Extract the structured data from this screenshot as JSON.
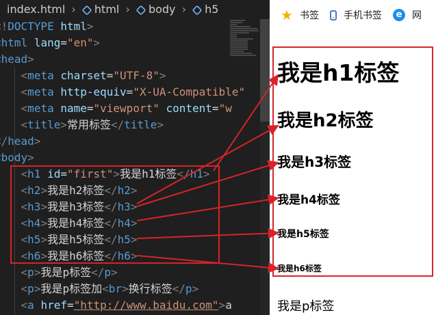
{
  "breadcrumb": {
    "file": "index.html",
    "items": [
      "html",
      "body",
      "h5"
    ]
  },
  "code_lines": [
    [
      {
        "c": "bracket",
        "t": "<!"
      },
      {
        "c": "tag",
        "t": "DOCTYPE"
      },
      {
        "c": "text",
        "t": " "
      },
      {
        "c": "attr",
        "t": "html"
      },
      {
        "c": "bracket",
        "t": ">"
      }
    ],
    [
      {
        "c": "bracket",
        "t": "<"
      },
      {
        "c": "tag",
        "t": "html"
      },
      {
        "c": "text",
        "t": " "
      },
      {
        "c": "attr",
        "t": "lang"
      },
      {
        "c": "text",
        "t": "="
      },
      {
        "c": "str",
        "t": "\"en\""
      },
      {
        "c": "bracket",
        "t": ">"
      }
    ],
    [
      {
        "c": "bracket",
        "t": "<"
      },
      {
        "c": "tag",
        "t": "head"
      },
      {
        "c": "bracket",
        "t": ">"
      }
    ],
    [
      {
        "c": "text",
        "t": "    "
      },
      {
        "c": "bracket",
        "t": "<"
      },
      {
        "c": "tag",
        "t": "meta"
      },
      {
        "c": "text",
        "t": " "
      },
      {
        "c": "attr",
        "t": "charset"
      },
      {
        "c": "text",
        "t": "="
      },
      {
        "c": "str",
        "t": "\"UTF-8\""
      },
      {
        "c": "bracket",
        "t": ">"
      }
    ],
    [
      {
        "c": "text",
        "t": "    "
      },
      {
        "c": "bracket",
        "t": "<"
      },
      {
        "c": "tag",
        "t": "meta"
      },
      {
        "c": "text",
        "t": " "
      },
      {
        "c": "attr",
        "t": "http-equiv"
      },
      {
        "c": "text",
        "t": "="
      },
      {
        "c": "str",
        "t": "\"X-UA-Compatible\""
      }
    ],
    [
      {
        "c": "text",
        "t": "    "
      },
      {
        "c": "bracket",
        "t": "<"
      },
      {
        "c": "tag",
        "t": "meta"
      },
      {
        "c": "text",
        "t": " "
      },
      {
        "c": "attr",
        "t": "name"
      },
      {
        "c": "text",
        "t": "="
      },
      {
        "c": "str",
        "t": "\"viewport\""
      },
      {
        "c": "text",
        "t": " "
      },
      {
        "c": "attr",
        "t": "content"
      },
      {
        "c": "text",
        "t": "="
      },
      {
        "c": "str",
        "t": "\"w"
      }
    ],
    [
      {
        "c": "text",
        "t": "    "
      },
      {
        "c": "bracket",
        "t": "<"
      },
      {
        "c": "tag",
        "t": "title"
      },
      {
        "c": "bracket",
        "t": ">"
      },
      {
        "c": "text",
        "t": "常用标签"
      },
      {
        "c": "bracket",
        "t": "</"
      },
      {
        "c": "tag",
        "t": "title"
      },
      {
        "c": "bracket",
        "t": ">"
      }
    ],
    [
      {
        "c": "bracket",
        "t": "</"
      },
      {
        "c": "tag",
        "t": "head"
      },
      {
        "c": "bracket",
        "t": ">"
      }
    ],
    [
      {
        "c": "bracket",
        "t": "<"
      },
      {
        "c": "tag",
        "t": "body"
      },
      {
        "c": "bracket",
        "t": ">"
      }
    ],
    [
      {
        "c": "text",
        "t": "    "
      },
      {
        "c": "bracket",
        "t": "<"
      },
      {
        "c": "tag",
        "t": "h1"
      },
      {
        "c": "text",
        "t": " "
      },
      {
        "c": "attr",
        "t": "id"
      },
      {
        "c": "text",
        "t": "="
      },
      {
        "c": "str",
        "t": "\"first\""
      },
      {
        "c": "bracket",
        "t": ">"
      },
      {
        "c": "text",
        "t": "我是h1标签"
      },
      {
        "c": "bracket",
        "t": "</"
      },
      {
        "c": "tag",
        "t": "h1"
      },
      {
        "c": "bracket",
        "t": ">"
      }
    ],
    [
      {
        "c": "text",
        "t": "    "
      },
      {
        "c": "bracket",
        "t": "<"
      },
      {
        "c": "tag",
        "t": "h2"
      },
      {
        "c": "bracket",
        "t": ">"
      },
      {
        "c": "text",
        "t": "我是h2标签"
      },
      {
        "c": "bracket",
        "t": "</"
      },
      {
        "c": "tag",
        "t": "h2"
      },
      {
        "c": "bracket",
        "t": ">"
      }
    ],
    [
      {
        "c": "text",
        "t": "    "
      },
      {
        "c": "bracket",
        "t": "<"
      },
      {
        "c": "tag",
        "t": "h3"
      },
      {
        "c": "bracket",
        "t": ">"
      },
      {
        "c": "text",
        "t": "我是h3标签"
      },
      {
        "c": "bracket",
        "t": "</"
      },
      {
        "c": "tag",
        "t": "h3"
      },
      {
        "c": "bracket",
        "t": ">"
      }
    ],
    [
      {
        "c": "text",
        "t": "    "
      },
      {
        "c": "bracket",
        "t": "<"
      },
      {
        "c": "tag",
        "t": "h4"
      },
      {
        "c": "bracket",
        "t": ">"
      },
      {
        "c": "text",
        "t": "我是h4标签"
      },
      {
        "c": "bracket",
        "t": "</"
      },
      {
        "c": "tag",
        "t": "h4"
      },
      {
        "c": "bracket",
        "t": ">"
      }
    ],
    [
      {
        "c": "text",
        "t": "    "
      },
      {
        "c": "bracket",
        "t": "<"
      },
      {
        "c": "tag",
        "t": "h5"
      },
      {
        "c": "bracket",
        "t": ">"
      },
      {
        "c": "text",
        "t": "我是h5标签"
      },
      {
        "c": "bracket",
        "t": "</"
      },
      {
        "c": "tag",
        "t": "h5"
      },
      {
        "c": "bracket",
        "t": ">"
      }
    ],
    [
      {
        "c": "text",
        "t": "    "
      },
      {
        "c": "bracket",
        "t": "<"
      },
      {
        "c": "tag",
        "t": "h6"
      },
      {
        "c": "bracket",
        "t": ">"
      },
      {
        "c": "text",
        "t": "我是h6标签"
      },
      {
        "c": "bracket",
        "t": "</"
      },
      {
        "c": "tag",
        "t": "h6"
      },
      {
        "c": "bracket",
        "t": ">"
      }
    ],
    [
      {
        "c": "text",
        "t": "    "
      },
      {
        "c": "bracket",
        "t": "<"
      },
      {
        "c": "tag",
        "t": "p"
      },
      {
        "c": "bracket",
        "t": ">"
      },
      {
        "c": "text",
        "t": "我是p标签"
      },
      {
        "c": "bracket",
        "t": "</"
      },
      {
        "c": "tag",
        "t": "p"
      },
      {
        "c": "bracket",
        "t": ">"
      }
    ],
    [
      {
        "c": "text",
        "t": "    "
      },
      {
        "c": "bracket",
        "t": "<"
      },
      {
        "c": "tag",
        "t": "p"
      },
      {
        "c": "bracket",
        "t": ">"
      },
      {
        "c": "text",
        "t": "我是p标签加"
      },
      {
        "c": "bracket",
        "t": "<"
      },
      {
        "c": "tag",
        "t": "br"
      },
      {
        "c": "bracket",
        "t": ">"
      },
      {
        "c": "text",
        "t": "换行标签"
      },
      {
        "c": "bracket",
        "t": "</"
      },
      {
        "c": "tag",
        "t": "p"
      },
      {
        "c": "bracket",
        "t": ">"
      }
    ],
    [
      {
        "c": "text",
        "t": "    "
      },
      {
        "c": "bracket",
        "t": "<"
      },
      {
        "c": "tag",
        "t": "a"
      },
      {
        "c": "text",
        "t": " "
      },
      {
        "c": "attr",
        "t": "href"
      },
      {
        "c": "text",
        "t": "="
      },
      {
        "c": "link",
        "t": "\"http://www.baidu.com\""
      },
      {
        "c": "bracket",
        "t": ">"
      },
      {
        "c": "text",
        "t": "a"
      }
    ]
  ],
  "bookmarks": [
    {
      "label": "书签",
      "icon": "star-icon"
    },
    {
      "label": "手机书签",
      "icon": "phone-icon"
    },
    {
      "label": "网",
      "icon": "edge-icon"
    }
  ],
  "rendered": {
    "headings": [
      {
        "level": "h1",
        "text": "我是h1标签"
      },
      {
        "level": "h2",
        "text": "我是h2标签"
      },
      {
        "level": "h3",
        "text": "我是h3标签"
      },
      {
        "level": "h4",
        "text": "我是h4标签"
      },
      {
        "level": "h5",
        "text": "我是h5标签"
      },
      {
        "level": "h6",
        "text": "我是h6标签"
      }
    ],
    "paragraph": "我是p标签"
  },
  "colors": {
    "annotation": "#d8232a",
    "editor_bg": "#1f1f1f",
    "tag": "#569cd6",
    "attribute": "#9cdcfe",
    "string": "#ce9178"
  }
}
